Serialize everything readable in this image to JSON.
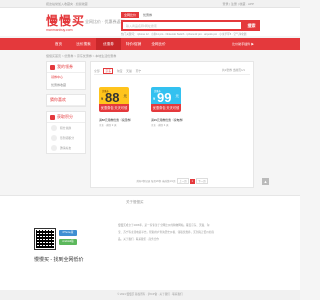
{
  "topbar": {
    "left_text": "把这站常加入收藏夹 · 加载收藏",
    "right_text": "登录 | 注册 | 收藏 · APP"
  },
  "header": {
    "logo_cn": "慢慢买",
    "logo_en": "manmanbuy.com",
    "slogan": "全网比价 · 优惠券返利",
    "search_tabs": [
      "全网比价",
      "优惠券"
    ],
    "search_placeholder": "输入商品名称/网址搜索",
    "search_button": "搜索",
    "hotwords": "热门关键词： iphone 12 · 小米11 pro · Nintendo Switch · iphone12 pro · airpods pro · 小米手环5 · 空气净化器"
  },
  "nav": {
    "items": [
      "首页",
      "比价搜索",
      "优惠券",
      "特价/促销",
      "全网比价"
    ],
    "active_index": 2,
    "right_text": "比价助手插件 ▶"
  },
  "breadcrumb": "慢慢买首页 > 优惠券 > 京东优惠券 > 本地生活优惠券",
  "sidebar": {
    "box1_title": "我的领券",
    "box1_items": [
      "领券中心",
      "优惠券收藏"
    ],
    "box2_title": "猜你喜欢",
    "box3_title": "获取积分",
    "box3_items": [
      "积分兑换",
      "签到领积分",
      "邀请好友"
    ]
  },
  "main": {
    "filters": [
      "全部",
      "京东",
      "淘宝",
      "天猫",
      "苏宁"
    ],
    "filter_selected": 1,
    "count_text": "共2张券 当前页1/1",
    "coupons": [
      {
        "label": "优惠券",
        "amount": "88",
        "unit": "元",
        "bottom": "优惠券包 天天可领",
        "title": "满88元用券优惠（家居券）",
        "meta": "京东 · 剩余 2 天"
      },
      {
        "label": "优惠券",
        "amount": "99",
        "unit": "元",
        "bottom": "优惠券包 天天可领",
        "title": "满99元用券优惠（家电券）",
        "meta": "京东 · 剩余 4 天"
      }
    ],
    "pager": [
      "上一页",
      "1",
      "下一页"
    ],
    "pager_text": "共有2条记录 每页20条 当前第1/1页"
  },
  "footer": {
    "title": "关于慢慢买",
    "app_buttons": [
      "iPhone版",
      "Android版"
    ],
    "brand": "慢慢买 - 找到全网低价",
    "text": "慢慢买成立于2006年，是一家专注于全网比价的购物网站，覆盖京东、天猫、淘宝、苏宁等主流电商平台，帮助用户查询历史价格、领取优惠券，买到真正低价的商品。关于我们 · 联系我们 · 商务合作",
    "copyright": "© 2021 慢慢买 版权所有 · 沪ICP备 · 关于我们 · 联系我们"
  },
  "colors": {
    "brand_red": "#e4393c",
    "coupon_yellow": "#ffc41c",
    "coupon_blue": "#33c1f0"
  }
}
